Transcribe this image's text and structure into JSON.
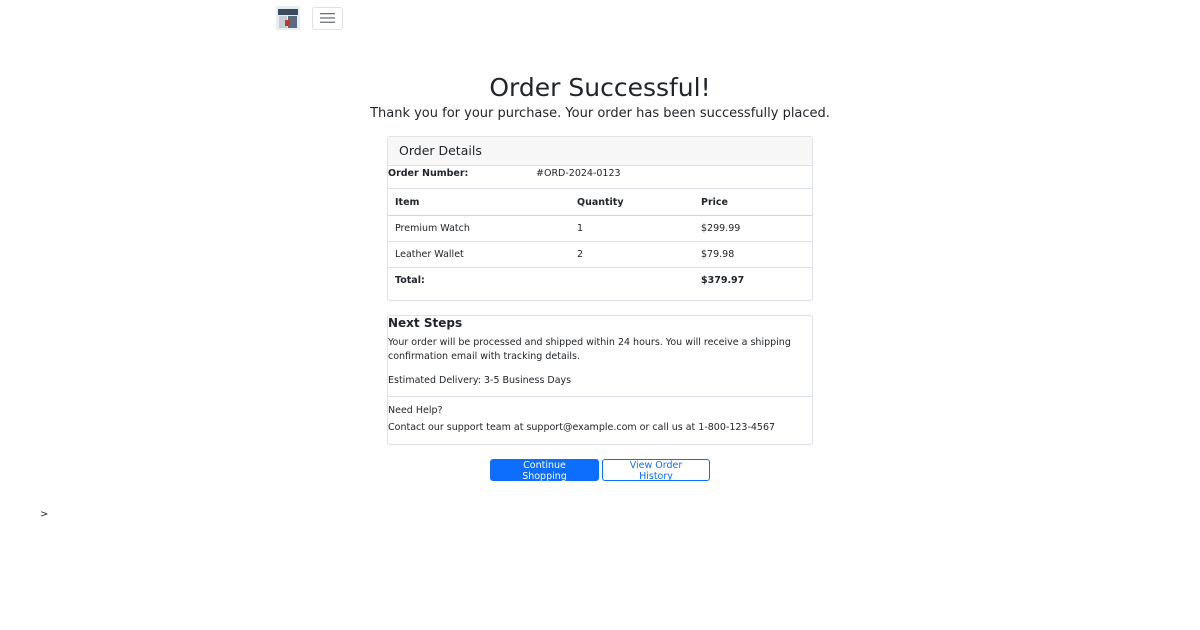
{
  "header": {
    "logo_icon": "store-logo-icon",
    "menu_icon": "hamburger-menu-icon"
  },
  "page": {
    "title": "Order Successful!",
    "subtitle": "Thank you for your purchase. Your order has been successfully placed."
  },
  "order_details": {
    "header": "Order Details",
    "order_number_label": "Order Number:",
    "order_number_value": "#ORD-2024-0123",
    "columns": [
      "Item",
      "Quantity",
      "Price"
    ],
    "rows": [
      {
        "item": "Premium Watch",
        "quantity": "1",
        "price": "$299.99"
      },
      {
        "item": "Leather Wallet",
        "quantity": "2",
        "price": "$79.98"
      }
    ],
    "total_label": "Total:",
    "total_value": "$379.97"
  },
  "next_steps": {
    "title": "Next Steps",
    "body": "Your order will be processed and shipped within 24 hours. You will receive a shipping confirmation email with tracking details.",
    "delivery": "Estimated Delivery: 3-5 Business Days",
    "help_title": "Need Help?",
    "help_text": "Contact our support team at support@example.com or call us at 1-800-123-4567"
  },
  "actions": {
    "continue_label": "Continue Shopping",
    "history_label": "View Order History"
  },
  "stray_text": ">",
  "colors": {
    "primary": "#0d6efd",
    "border": "#dee2e6",
    "header_bg": "#f7f7f7"
  }
}
